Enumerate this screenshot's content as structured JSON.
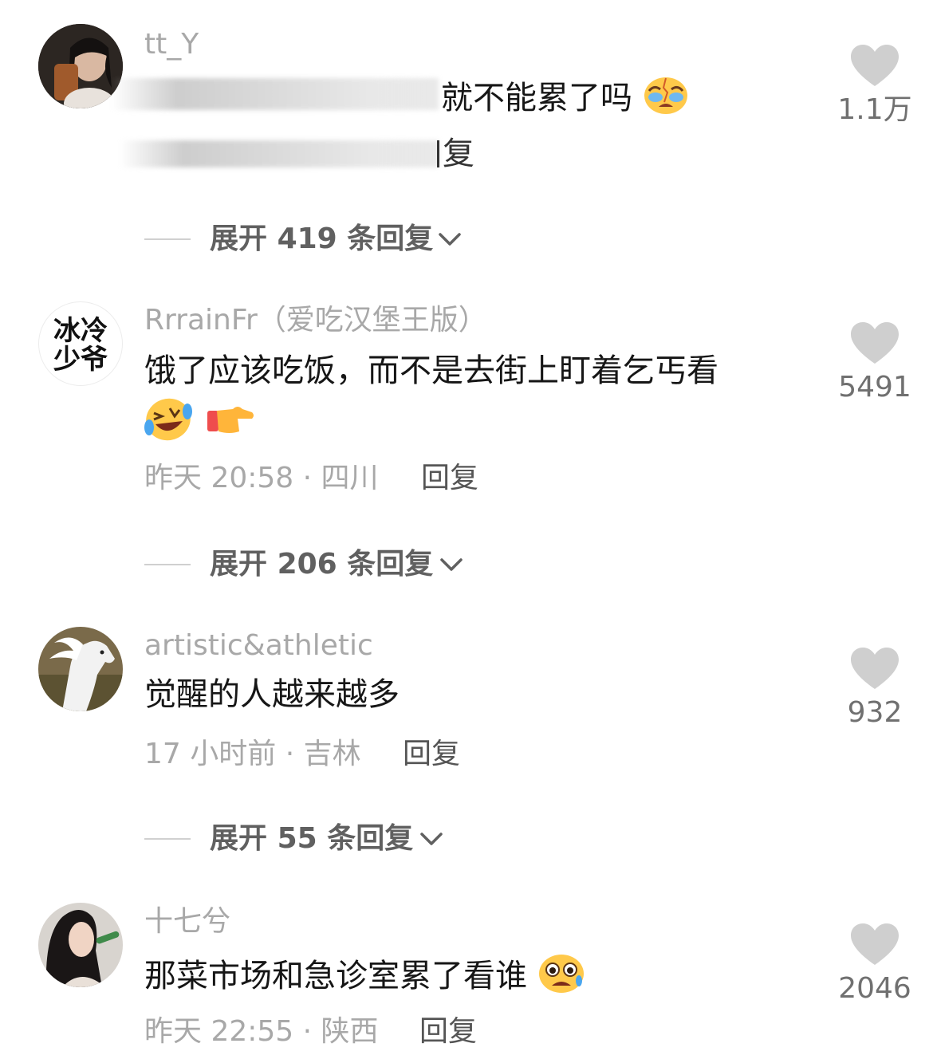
{
  "comments": [
    {
      "username": "tt_Y",
      "content": "就不能累了吗",
      "content_tail_fragment": "复",
      "likes": "1.1万",
      "expand": {
        "prefix": "展开",
        "count": "419",
        "suffix": "条回复"
      }
    },
    {
      "username": "RrrainFr（爱吃汉堡王版）",
      "content_line1": "饿了应该吃饭，而不是去街上盯着乞丐看",
      "meta": "昨天 20:58 · 四川",
      "reply": "回复",
      "likes": "5491",
      "avatar_text": [
        "冰冷",
        "少爷"
      ],
      "expand": {
        "prefix": "展开",
        "count": "206",
        "suffix": "条回复"
      }
    },
    {
      "username": "artistic&athletic",
      "content": "觉醒的人越来越多",
      "meta": "17 小时前 · 吉林",
      "reply": "回复",
      "likes": "932",
      "expand": {
        "prefix": "展开",
        "count": "55",
        "suffix": "条回复"
      }
    },
    {
      "username": "十七兮",
      "content": "那菜市场和急诊室累了看谁",
      "meta": "昨天 22:55 · 陕西",
      "reply": "回复",
      "likes": "2046"
    }
  ],
  "icons": {
    "heart": "heart-icon",
    "chevron": "chevron-down-icon",
    "crying_emoji": "crying-face-emoji",
    "laughing_emoji": "laughing-tears-emoji",
    "pointing_emoji": "pointing-right-emoji",
    "fearful_emoji": "anxious-face-emoji"
  },
  "colors": {
    "text_primary": "#161616",
    "text_secondary": "#a8a8a8",
    "heart": "#cfcfcf"
  }
}
